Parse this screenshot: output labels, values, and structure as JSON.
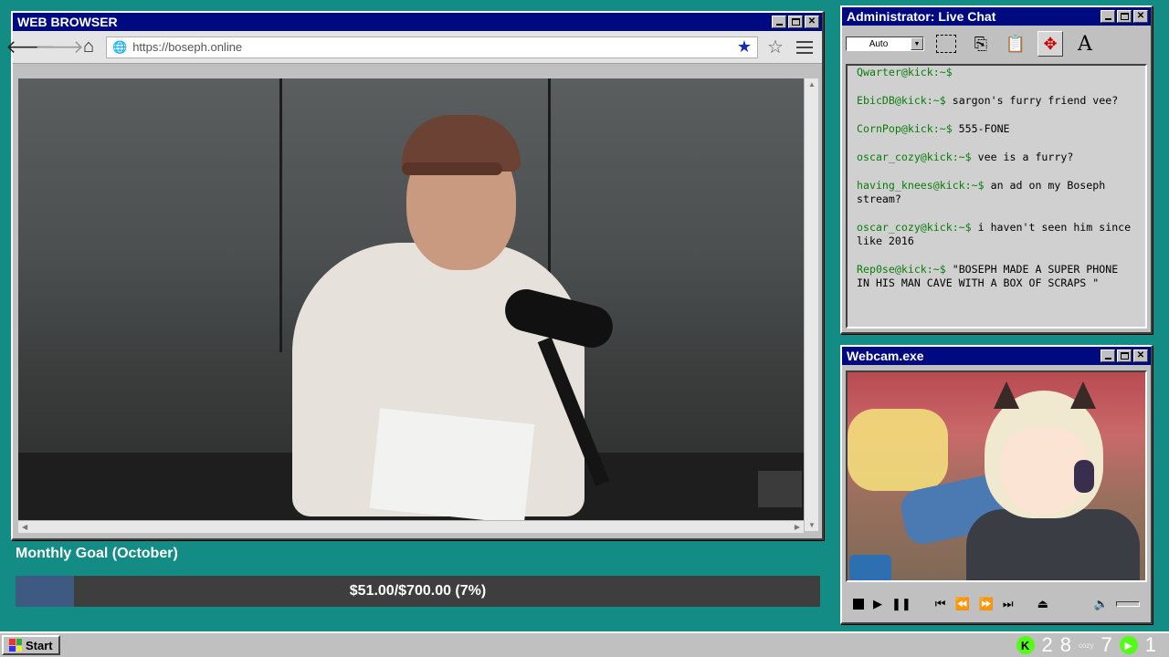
{
  "browser": {
    "title": "WEB BROWSER",
    "url": "https://boseph.online",
    "icons": [
      "back-arrow-icon",
      "forward-arrow-icon",
      "home-icon",
      "globe-icon",
      "star-filled-icon",
      "star-outline-icon",
      "menu-icon"
    ]
  },
  "goal": {
    "label": "Monthly Goal (October)",
    "text": "$51.00/$700.00 (7%)",
    "current": 51.0,
    "target": 700.0,
    "percent": 7,
    "fill_color": "#3f5a82"
  },
  "chat": {
    "title": "Administrator: Live Chat",
    "font_select": "Auto",
    "messages": [
      {
        "user": "Qwarter@kick:~$",
        "text": ""
      },
      {
        "user": "EbicDB@kick:~$",
        "text": " sargon's furry friend vee?"
      },
      {
        "user": "CornPop@kick:~$",
        "text": " 555-FONE"
      },
      {
        "user": "oscar_cozy@kick:~$",
        "text": " vee is a furry?"
      },
      {
        "user": "having_knees@kick:~$",
        "text": " an ad on my Boseph stream?"
      },
      {
        "user": "oscar_cozy@kick:~$",
        "text": " i haven't seen him since like 2016"
      },
      {
        "user": "Rep0se@kick:~$",
        "text": " \"BOSEPH MADE A SUPER PHONE IN HIS MAN CAVE WITH A BOX OF SCRAPS \""
      }
    ],
    "user_color": "#0a7d0a"
  },
  "webcam": {
    "title": "Webcam.exe"
  },
  "taskbar": {
    "start": "Start",
    "kick_icon": "K",
    "count_a": "2",
    "count_b": "8",
    "cozy": "cozy",
    "count_c": "7",
    "count_d": "1"
  },
  "colors": {
    "desktop": "#128c84",
    "titlebar": "#000a80",
    "kick_green": "#53fc18"
  }
}
